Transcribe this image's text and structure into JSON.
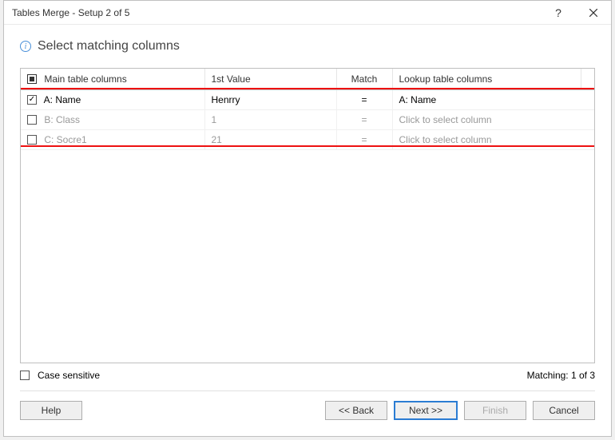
{
  "window": {
    "title": "Tables Merge - Setup 2 of 5"
  },
  "heading": "Select matching columns",
  "columns": {
    "main": "Main table columns",
    "value": "1st Value",
    "match": "Match",
    "lookup": "Lookup table columns"
  },
  "rows": [
    {
      "checked": true,
      "main": "A: Name",
      "value": "Henrry",
      "match": "=",
      "lookup": "A: Name"
    },
    {
      "checked": false,
      "main": "B: Class",
      "value": "1",
      "match": "=",
      "lookup": "Click to select column"
    },
    {
      "checked": false,
      "main": "C: Socre1",
      "value": "21",
      "match": "=",
      "lookup": "Click to select column"
    }
  ],
  "case_sensitive_label": "Case sensitive",
  "matching_text": "Matching: 1 of 3",
  "buttons": {
    "help": "Help",
    "back": "<< Back",
    "next": "Next >>",
    "finish": "Finish",
    "cancel": "Cancel"
  }
}
